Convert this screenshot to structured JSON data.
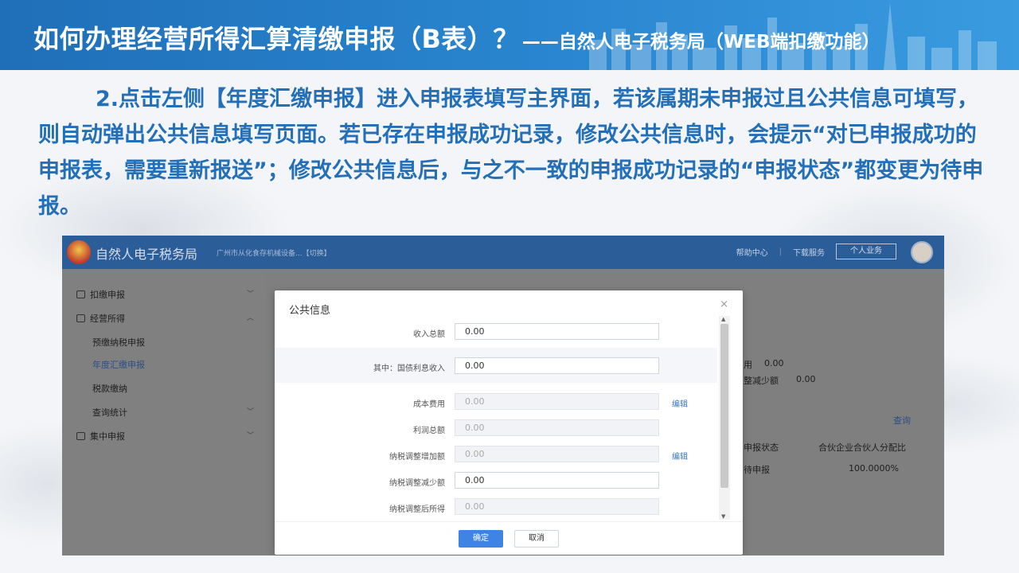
{
  "slide": {
    "title": "如何办理经营所得汇算清缴申报（B表）？",
    "subtitle": "——自然人电子税务局（WEB端扣缴功能）",
    "paragraph": "2.点击左侧【年度汇缴申报】进入申报表填写主界面，若该属期未申报过且公共信息可填写，则自动弹出公共信息填写页面。若已存在申报成功记录，修改公共信息时，会提示“对已申报成功的申报表，需要重新报送”；修改公共信息后，与之不一致的申报成功记录的“申报状态”都变更为待申报。"
  },
  "app": {
    "name": "自然人电子税务局",
    "org": "广州市从化食存机械设备...【切换】",
    "links": [
      "帮助中心",
      "|",
      "下载服务"
    ],
    "personal_button": "个人业务"
  },
  "sidebar": {
    "items": [
      {
        "label": "扣缴申报"
      },
      {
        "label": "经营所得"
      },
      {
        "label": "预缴纳税申报"
      },
      {
        "label": "年度汇缴申报"
      },
      {
        "label": "税款缴纳"
      },
      {
        "label": "查询统计"
      },
      {
        "label": "集中申报"
      }
    ]
  },
  "background_content": {
    "cost_label": "用",
    "cost_value": "0.00",
    "reduce_label": "整减少额",
    "reduce_value": "0.00",
    "query": "查询",
    "col_status": "申报状态",
    "col_ratio": "合伙企业合伙人分配比",
    "row_status": "待申报",
    "row_ratio": "100.0000%"
  },
  "modal": {
    "title": "公共信息",
    "close": "×",
    "rows": [
      {
        "label": "收入总额",
        "value": "0.00",
        "disabled": false,
        "edit": ""
      },
      {
        "label": "其中：国债利息收入",
        "value": "0.00",
        "disabled": false,
        "edit": ""
      },
      {
        "label": "成本费用",
        "value": "0.00",
        "disabled": true,
        "edit": "编辑"
      },
      {
        "label": "利润总额",
        "value": "0.00",
        "disabled": true,
        "edit": ""
      },
      {
        "label": "纳税调整增加额",
        "value": "0.00",
        "disabled": true,
        "edit": "编辑"
      },
      {
        "label": "纳税调整减少额",
        "value": "0.00",
        "disabled": false,
        "edit": ""
      },
      {
        "label": "纳税调整后所得",
        "value": "0.00",
        "disabled": true,
        "edit": ""
      }
    ],
    "ok": "确定",
    "cancel": "取消"
  }
}
